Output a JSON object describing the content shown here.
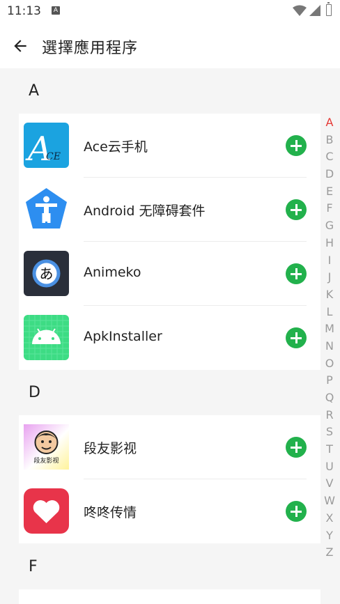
{
  "status_bar": {
    "time": "11:13",
    "notif_glyph": "A"
  },
  "app_bar": {
    "title": "選擇應用程序"
  },
  "sections": [
    {
      "header": "A",
      "apps": [
        {
          "name": "Ace云手机",
          "icon": "ace-cloud-phone-icon"
        },
        {
          "name": "Android 无障碍套件",
          "icon": "accessibility-icon"
        },
        {
          "name": "Animeko",
          "icon": "animeko-icon"
        },
        {
          "name": "ApkInstaller",
          "icon": "android-robot-icon"
        }
      ]
    },
    {
      "header": "D",
      "apps": [
        {
          "name": "段友影视",
          "icon": "duanyou-avatar-icon"
        },
        {
          "name": "咚咚传情",
          "icon": "heart-icon"
        }
      ]
    },
    {
      "header": "F",
      "apps": []
    }
  ],
  "index_letters": [
    "A",
    "B",
    "C",
    "D",
    "E",
    "F",
    "G",
    "H",
    "I",
    "J",
    "K",
    "L",
    "M",
    "N",
    "O",
    "P",
    "Q",
    "R",
    "S",
    "T",
    "U",
    "V",
    "W",
    "X",
    "Y",
    "Z"
  ],
  "active_letter": "A",
  "colors": {
    "add_button": "#22b14c",
    "active_index": "#e53935",
    "ace_icon_bg": "#1ba3e0",
    "heart_bg": "#e8344a"
  },
  "ace_icon_text": {
    "big": "A",
    "small": "CE"
  },
  "animeko_glyph": "あ",
  "duanyou_caption": "段友影视"
}
